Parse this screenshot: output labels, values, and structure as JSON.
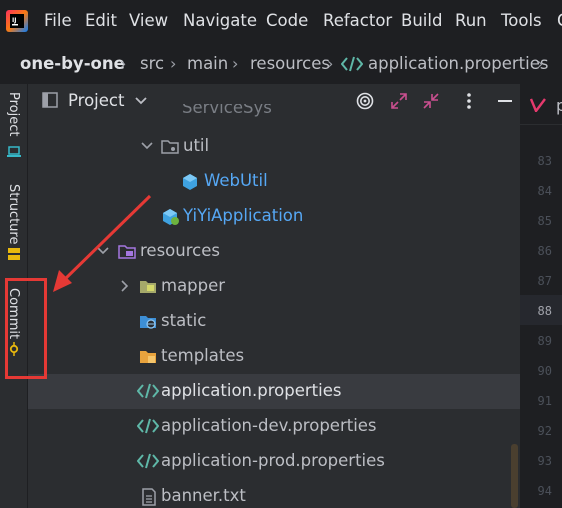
{
  "menu": {
    "items": [
      "File",
      "Edit",
      "View",
      "Navigate",
      "Code",
      "Refactor",
      "Build",
      "Run",
      "Tools",
      "G"
    ]
  },
  "breadcrumb": {
    "project": "one-by-one",
    "segments": [
      "src",
      "main",
      "resources",
      "application.properties"
    ]
  },
  "toolstrip": {
    "project_label": "Project",
    "structure_label": "Structure",
    "commit_label": "Commit"
  },
  "panel": {
    "title": "Project",
    "partial_top_item": "ServiceSys",
    "tree": [
      {
        "label": "util",
        "kind": "package",
        "expanded": true
      },
      {
        "label": "WebUtil",
        "kind": "class"
      },
      {
        "label": "YiYiApplication",
        "kind": "spring-class"
      },
      {
        "label": "resources",
        "kind": "resources-folder",
        "expanded": true
      },
      {
        "label": "mapper",
        "kind": "folder",
        "expanded": false
      },
      {
        "label": "static",
        "kind": "web-folder"
      },
      {
        "label": "templates",
        "kind": "templates-folder"
      },
      {
        "label": "application.properties",
        "kind": "properties",
        "selected": true
      },
      {
        "label": "application-dev.properties",
        "kind": "properties"
      },
      {
        "label": "application-prod.properties",
        "kind": "properties"
      },
      {
        "label": "banner.txt",
        "kind": "text"
      }
    ]
  },
  "editor": {
    "tab_partial": "p",
    "line_numbers": [
      "83",
      "84",
      "85",
      "86",
      "87",
      "88",
      "89",
      "90",
      "91",
      "92",
      "93",
      "94"
    ],
    "current_line": "88"
  },
  "colors": {
    "annotation_red": "#e53935",
    "java_blue": "#56a8f5",
    "selection": "#393b40"
  }
}
